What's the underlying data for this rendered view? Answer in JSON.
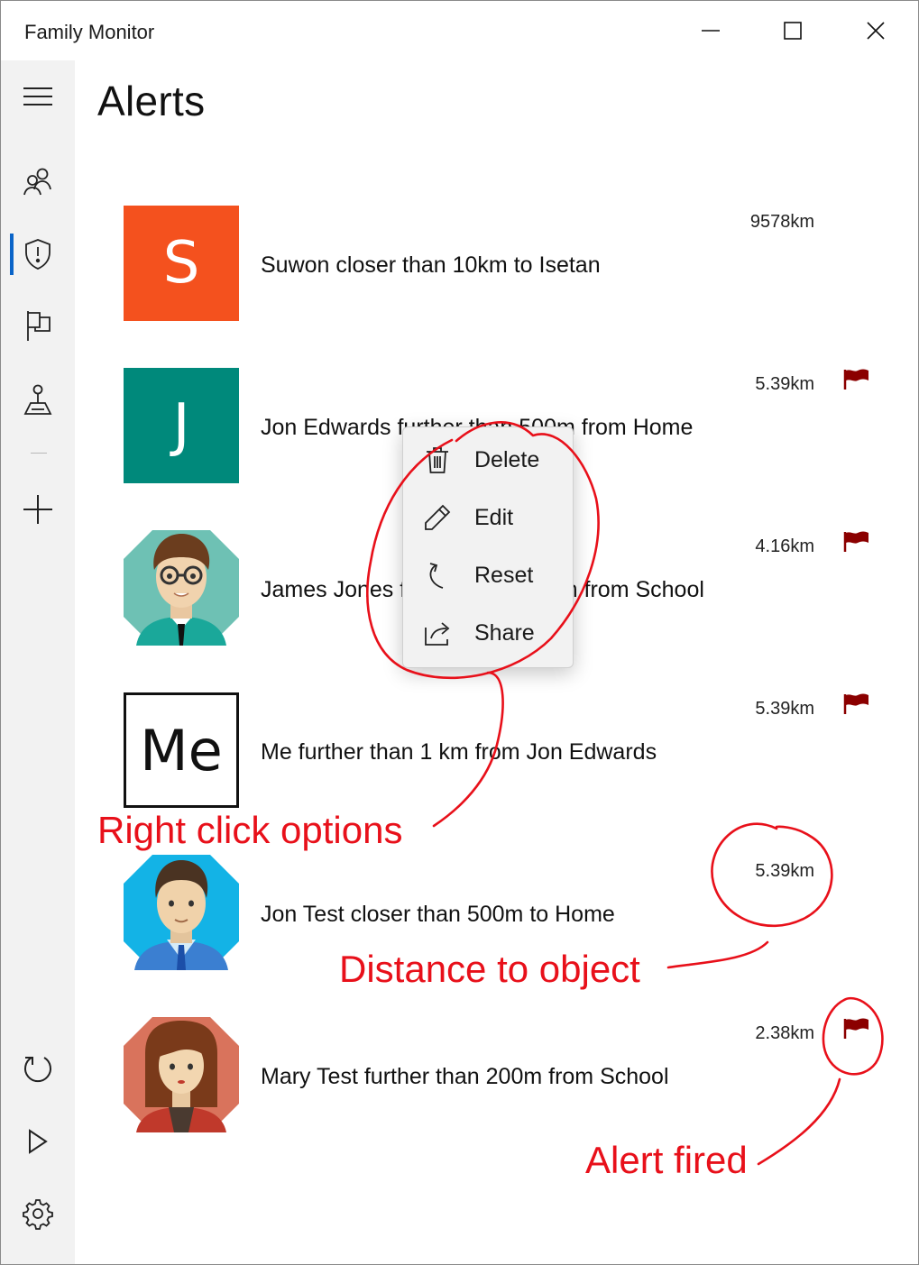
{
  "window": {
    "title": "Family Monitor",
    "controls": [
      "minimize",
      "maximize",
      "close"
    ]
  },
  "sidebar": {
    "items": [
      {
        "icon": "hamburger-menu-icon"
      },
      {
        "icon": "people-icon"
      },
      {
        "icon": "shield-alert-icon",
        "selected": true
      },
      {
        "icon": "flag-icon"
      },
      {
        "icon": "map-pin-icon"
      },
      {
        "icon": "add-icon"
      },
      {
        "icon": "refresh-icon"
      },
      {
        "icon": "play-icon"
      },
      {
        "icon": "settings-icon"
      }
    ]
  },
  "page": {
    "title": "Alerts"
  },
  "alerts": [
    {
      "avatar_type": "letter",
      "avatar_letter": "S",
      "avatar_color": "#f4511e",
      "text": "Suwon closer than 10km to Isetan",
      "distance": "9578km",
      "fired": false
    },
    {
      "avatar_type": "letter",
      "avatar_letter": "J",
      "avatar_color": "#00897b",
      "text": "Jon Edwards further than 500m from Home",
      "distance": "5.39km",
      "fired": true
    },
    {
      "avatar_type": "photo",
      "avatar_icon": "man-glasses-avatar",
      "text": "James Jones further than 500m from School",
      "distance": "4.16km",
      "fired": true
    },
    {
      "avatar_type": "letter",
      "avatar_letter": "Me",
      "avatar_color": "#ffffff",
      "text": "Me further than 1 km from Jon Edwards",
      "distance": "5.39km",
      "fired": true
    },
    {
      "avatar_type": "photo",
      "avatar_icon": "man-blue-avatar",
      "text": "Jon Test closer than 500m to Home",
      "distance": "5.39km",
      "fired": false
    },
    {
      "avatar_type": "photo",
      "avatar_icon": "woman-avatar",
      "text": "Mary Test further than 200m from School",
      "distance": "2.38km",
      "fired": true
    }
  ],
  "context_menu": {
    "items": [
      {
        "label": "Delete",
        "icon": "trash-icon"
      },
      {
        "label": "Edit",
        "icon": "pencil-icon"
      },
      {
        "label": "Reset",
        "icon": "reset-icon"
      },
      {
        "label": "Share",
        "icon": "share-icon"
      }
    ]
  },
  "annotations": {
    "right_click": "Right click options",
    "distance": "Distance to object",
    "alert_fired": "Alert fired"
  },
  "colors": {
    "accent": "#0a64c8",
    "flag": "#8b0000",
    "annotation": "#e8101a"
  }
}
